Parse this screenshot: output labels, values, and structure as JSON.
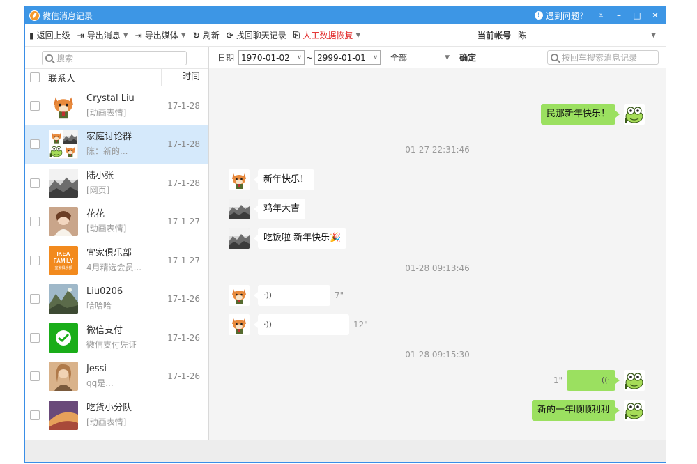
{
  "window": {
    "title": "微信消息记录",
    "help_label": "遇到问题？"
  },
  "toolbar": {
    "back": "返回上级",
    "export_msg": "导出消息",
    "export_media": "导出媒体",
    "refresh": "刷新",
    "recover_chat": "找回聊天记录",
    "manual_recovery": "人工数据恢复",
    "account_label": "当前帐号",
    "account_value": "陈"
  },
  "sidebar": {
    "search_placeholder": "搜索",
    "header_name": "联系人",
    "header_time": "时间",
    "contacts": [
      {
        "name": "Crystal Liu",
        "sub": "[动画表情]",
        "time": "17-1-28"
      },
      {
        "name": "家庭讨论群",
        "sub": "陈：新的...",
        "time": "17-1-28"
      },
      {
        "name": "陆小张",
        "sub": "[网页]",
        "time": "17-1-28"
      },
      {
        "name": "花花",
        "sub": "[动画表情]",
        "time": "17-1-27"
      },
      {
        "name": "宜家俱乐部",
        "sub": "4月精选会员...",
        "time": "17-1-27"
      },
      {
        "name": "Liu0206",
        "sub": "哈哈哈",
        "time": "17-1-26"
      },
      {
        "name": "微信支付",
        "sub": "微信支付凭证",
        "time": "17-1-26"
      },
      {
        "name": "Jessi",
        "sub": "qq是...",
        "time": "17-1-26"
      },
      {
        "name": "吃货小分队",
        "sub": "[动画表情]",
        "time": ""
      }
    ],
    "ikea_logo": {
      "l1": "IKEA",
      "l2": "FAMILY",
      "l3": "宜家俱乐部"
    }
  },
  "filter": {
    "date_label": "日期",
    "date_from": "1970-01-02",
    "date_to": "2999-01-01",
    "separator": "~",
    "type": "全部",
    "confirm": "确定",
    "search_placeholder": "按回车搜索消息记录"
  },
  "chat": {
    "msg1": "民那新年快乐！",
    "ts1": "01-27 22:31:46",
    "msg2": "新年快乐！",
    "msg3": "鸡年大吉",
    "msg4": "吃饭啦 新年快乐🎉",
    "ts2": "01-28 09:13:46",
    "voice1_dur": "7\"",
    "voice2_dur": "12\"",
    "ts3": "01-28 09:15:30",
    "voice3_dur": "1\"",
    "msg5": "新的一年顺顺利利"
  },
  "colors": {
    "titlebar": "#3d96e5",
    "my_bubble": "#9be060",
    "selected_row": "#d5e9fb",
    "recovery_red": "#e02020"
  }
}
